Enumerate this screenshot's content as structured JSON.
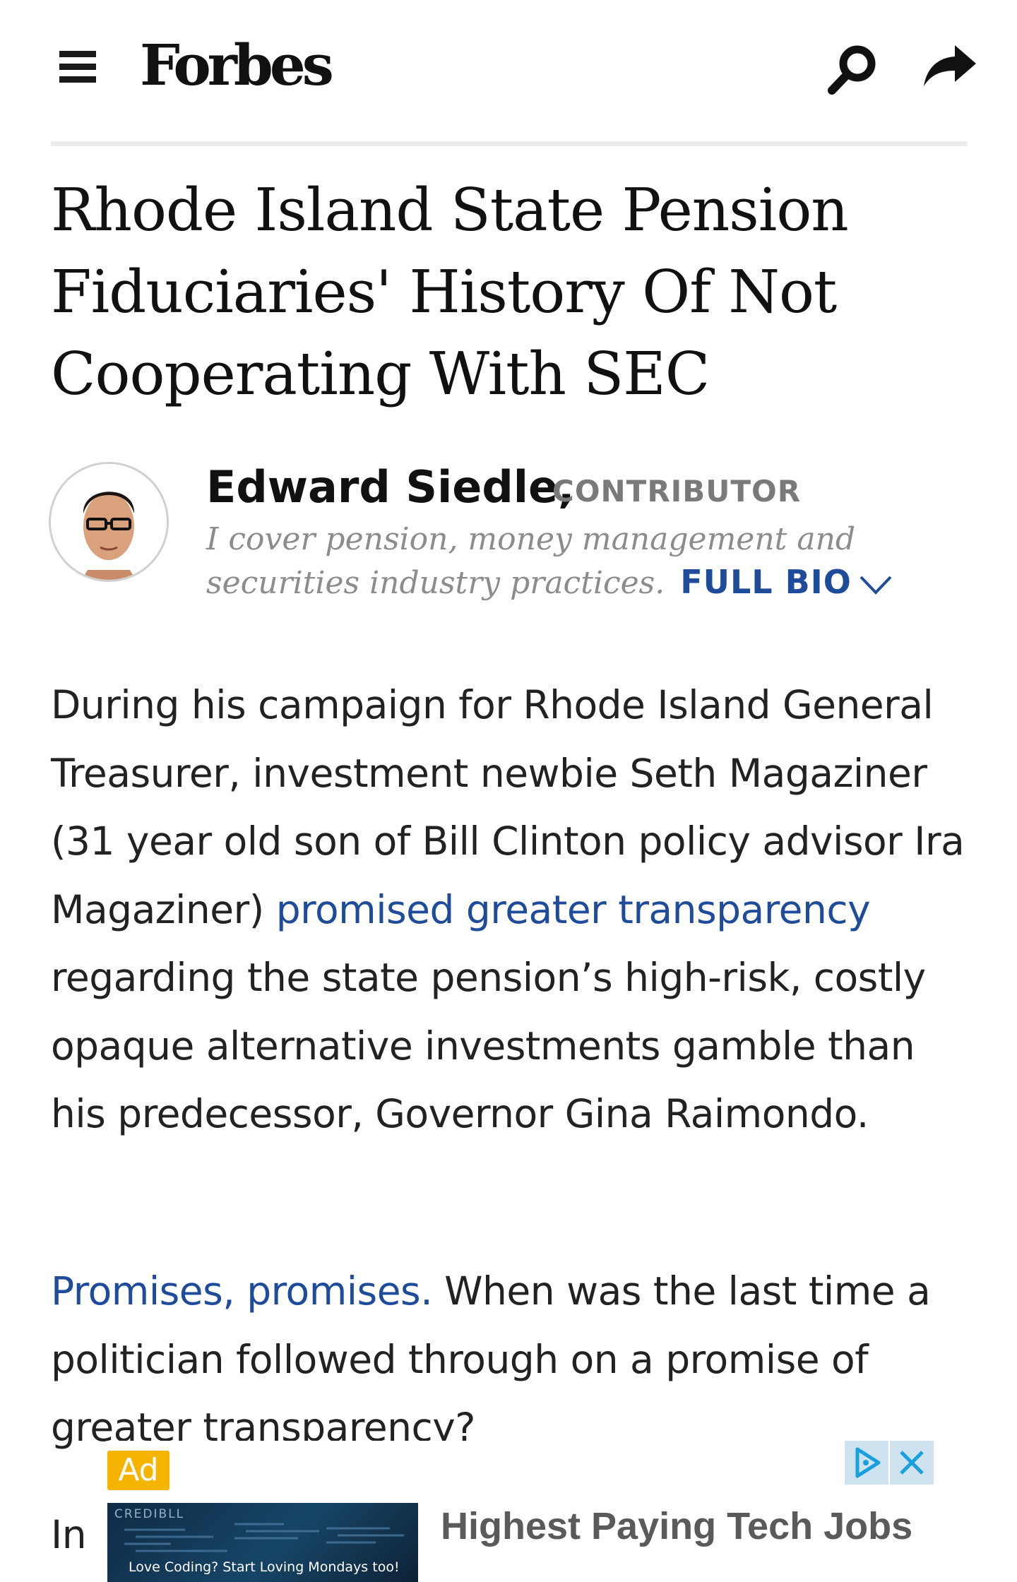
{
  "header": {
    "logo": "Forbes",
    "menu_icon": "hamburger-menu-icon",
    "search_icon": "search-icon",
    "share_icon": "share-arrow-icon"
  },
  "article": {
    "headline": "Rhode Island State Pension Fiduciaries' History Of Not Cooperating With SEC",
    "author": {
      "name": "Edward Siedle,",
      "role": "CONTRIBUTOR",
      "bio": "I cover pension, money management and securities industry practices.",
      "full_bio_label": "FULL BIO"
    },
    "paragraphs": {
      "p1_part1": "During his campaign for Rhode Island General Treasurer, investment newbie Seth Magaziner (31 year old son of Bill Clinton policy advisor Ira Magaziner) ",
      "p1_link": "promised greater transparency",
      "p1_part2": " regarding the state pension’s high-risk, costly opaque alternative investments gamble than his predecessor, Governor Gina Raimondo.",
      "p2_link": "Promises, promises.",
      "p2_part2": " When was the last time a politician followed through on a promise of greater transparency?",
      "p3_start": "In"
    }
  },
  "ad": {
    "badge": "Ad",
    "brand": "CREDIBLL",
    "tagline": "Love Coding? Start Loving Mondays too!",
    "headline": "Highest Paying Tech Jobs",
    "adchoices_icon": "adchoices-icon",
    "close_icon": "close-icon"
  },
  "colors": {
    "link": "#1f4c9a",
    "ad_badge": "#f4b400",
    "ad_controls": "#cfe2f0"
  }
}
